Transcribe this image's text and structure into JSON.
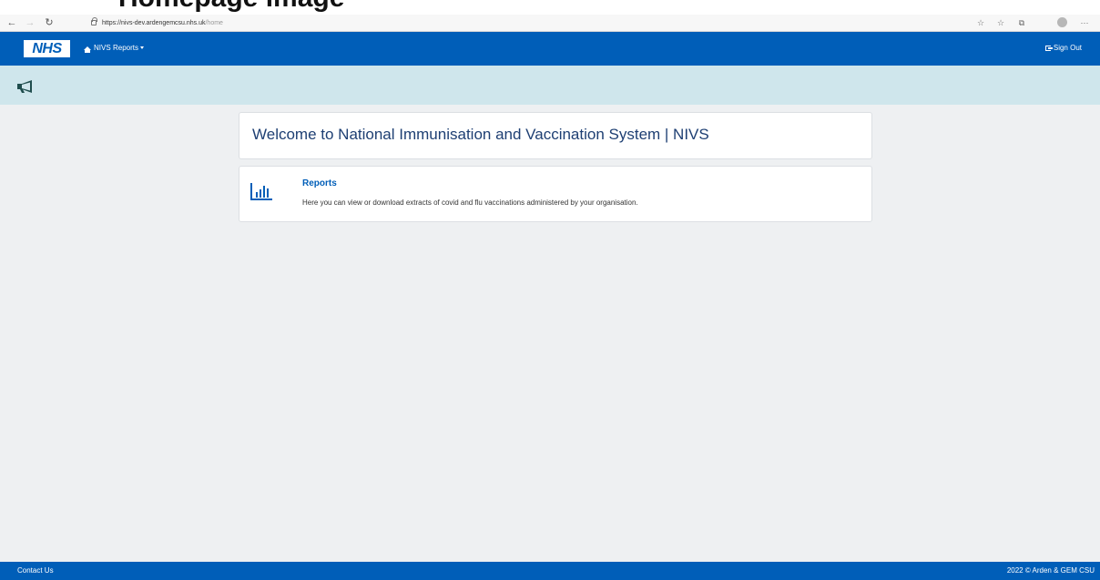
{
  "heading_fragment": "Homepage image",
  "browser": {
    "url_host": "https://nivs-dev.ardengemcsu.nhs.uk",
    "url_path": "/home"
  },
  "nav": {
    "logo": "NHS",
    "home_label": "NIVS",
    "reports_label": "Reports",
    "signout_label": "Sign Out"
  },
  "welcome": {
    "title": "Welcome to National Immunisation and Vaccination System | NIVS"
  },
  "reports_card": {
    "title": "Reports",
    "description": "Here you can view or download extracts of covid and flu vaccinations administered by your organisation."
  },
  "footer": {
    "contact": "Contact Us",
    "copyright": "2022 © Arden & GEM CSU"
  },
  "colors": {
    "nhs_blue": "#005eb8",
    "announce_bg": "#cfe6ec",
    "page_bg": "#eef0f2",
    "icon_dark_teal": "#1f4d4d"
  },
  "icons": {
    "announcement": "megaphone-icon",
    "reports": "bar-chart-icon",
    "home": "home-icon",
    "signout": "sign-out-icon"
  }
}
